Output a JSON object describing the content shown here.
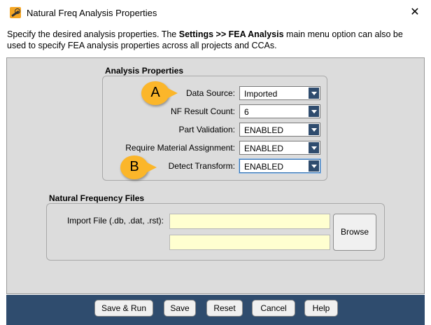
{
  "window": {
    "title": "Natural Freq Analysis Properties",
    "close_glyph": "✕"
  },
  "description": {
    "prefix": "Specify the desired analysis properties. The ",
    "bold": "Settings >> FEA Analysis",
    "suffix": " main menu option can also be used to specify FEA analysis properties across all projects and CCAs."
  },
  "analysis_properties": {
    "title": "Analysis Properties",
    "fields": [
      {
        "label": "Data Source:",
        "value": "Imported"
      },
      {
        "label": "NF Result Count:",
        "value": "6"
      },
      {
        "label": "Part Validation:",
        "value": "ENABLED"
      },
      {
        "label": "Require Material Assignment:",
        "value": "ENABLED"
      },
      {
        "label": "Detect Transform:",
        "value": "ENABLED"
      }
    ]
  },
  "callouts": {
    "a": "A",
    "b": "B",
    "color": "#fbb62a"
  },
  "natural_frequency_files": {
    "title": "Natural Frequency Files",
    "import_label": "Import File (.db, .dat, .rst):",
    "file1": "",
    "file2": "",
    "browse_label": "Browse"
  },
  "footer": {
    "buttons": [
      "Save & Run",
      "Save",
      "Reset",
      "Cancel",
      "Help"
    ],
    "color": "#2f4c6e"
  }
}
